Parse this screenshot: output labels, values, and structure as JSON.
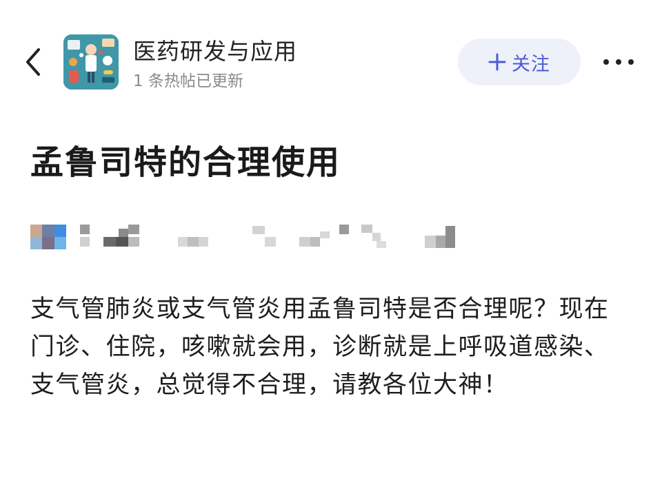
{
  "header": {
    "back_icon": "chevron-left-icon",
    "board_name": "医药研发与应用",
    "board_sub": "1 条热帖已更新",
    "follow_label": "关注",
    "follow_icon": "plus-icon",
    "more_icon": "more-horizontal-icon"
  },
  "post": {
    "title": "孟鲁司特的合理使用",
    "body": "支气管肺炎或支气管炎用孟鲁司特是否合理呢？现在门诊、住院，咳嗽就会用，诊断就是上呼吸道感染、支气管炎，总觉得不合理，请教各位大神！"
  },
  "colors": {
    "accent": "#4b5bd6",
    "follow_bg": "#eef0fa",
    "avatar_bg": "#3a8fa0",
    "subtext": "#8a8a8a"
  }
}
